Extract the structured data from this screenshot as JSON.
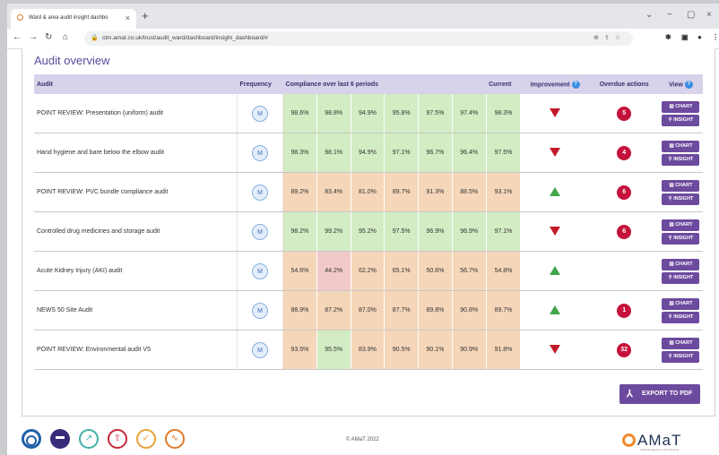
{
  "browser": {
    "tab_title": "Ward & area audit insight dashbo",
    "tab_close": "×",
    "new_tab": "+",
    "url": "ctm.amat.co.uk/trust/audit_ward/dashboard/insight_dashboard/#",
    "window_controls": {
      "chevron": "⌄",
      "minimize": "−",
      "maximize": "▢",
      "close": "×"
    }
  },
  "page": {
    "title": "Audit overview",
    "columns": {
      "audit": "Audit",
      "frequency": "Frequency",
      "compliance": "Compliance over last 6 periods",
      "current": "Current",
      "improvement": "Improvement",
      "overdue": "Overdue actions",
      "view": "View"
    },
    "help_glyph": "?",
    "chart_label": "CHART",
    "insight_label": "INSIGHT",
    "rows": [
      {
        "name": "POINT REVIEW: Presentation (uniform) audit",
        "freq": "M",
        "values": [
          "98.6%",
          "98.8%",
          "94.9%",
          "95.8%",
          "97.5%",
          "97.4%"
        ],
        "current": "98.3%",
        "improvement": "down",
        "overdue": "5"
      },
      {
        "name": "Hand hygiene and bare below the elbow audit",
        "freq": "M",
        "values": [
          "98.3%",
          "98.1%",
          "94.9%",
          "97.1%",
          "96.7%",
          "96.4%"
        ],
        "current": "97.5%",
        "improvement": "down",
        "overdue": "4"
      },
      {
        "name": "POINT REVIEW: PVC bundle compliance audit",
        "freq": "M",
        "values": [
          "89.2%",
          "83.4%",
          "81.0%",
          "89.7%",
          "91.3%",
          "88.5%"
        ],
        "current": "93.1%",
        "improvement": "up",
        "overdue": "6"
      },
      {
        "name": "Controlled drug medicines and storage audit",
        "freq": "M",
        "values": [
          "98.2%",
          "99.2%",
          "95.2%",
          "97.5%",
          "96.9%",
          "96.9%"
        ],
        "current": "97.1%",
        "improvement": "down",
        "overdue": "6"
      },
      {
        "name": "Acute Kidney Injury (AKI) audit",
        "freq": "M",
        "values": [
          "54.6%",
          "44.2%",
          "62.2%",
          "65.1%",
          "50.6%",
          "56.7%"
        ],
        "current": "54.8%",
        "improvement": "up",
        "overdue": ""
      },
      {
        "name": "NEWS 50 Site Audit",
        "freq": "M",
        "values": [
          "88.9%",
          "87.2%",
          "87.0%",
          "87.7%",
          "89.8%",
          "90.8%"
        ],
        "current": "89.7%",
        "improvement": "up",
        "overdue": "1"
      },
      {
        "name": "POINT REVIEW: Environmental audit V5",
        "freq": "M",
        "values": [
          "93.5%",
          "95.5%",
          "83.9%",
          "90.5%",
          "90.1%",
          "90.9%"
        ],
        "current": "91.8%",
        "improvement": "down",
        "overdue": "32"
      }
    ],
    "export_label": "EXPORT TO PDF"
  },
  "footer": {
    "copyright": "© AMaT 2022",
    "logo_text": "AMaT",
    "logo_sub": "Audit Management and Tracking",
    "icons": [
      "lifebuoy-icon",
      "bed-icon",
      "trend-chart-icon",
      "upload-icon",
      "checklist-icon",
      "heartbeat-icon"
    ]
  },
  "colors": {
    "accent": "#6c4a9e",
    "header_bg": "#d8d2ea",
    "green": "#d3ecc3",
    "amber": "#f5d6b9",
    "red_cell": "#f2c9c9",
    "badge": "#c5123a",
    "arrow_down": "#c21a2a",
    "arrow_up": "#3fa64a"
  }
}
